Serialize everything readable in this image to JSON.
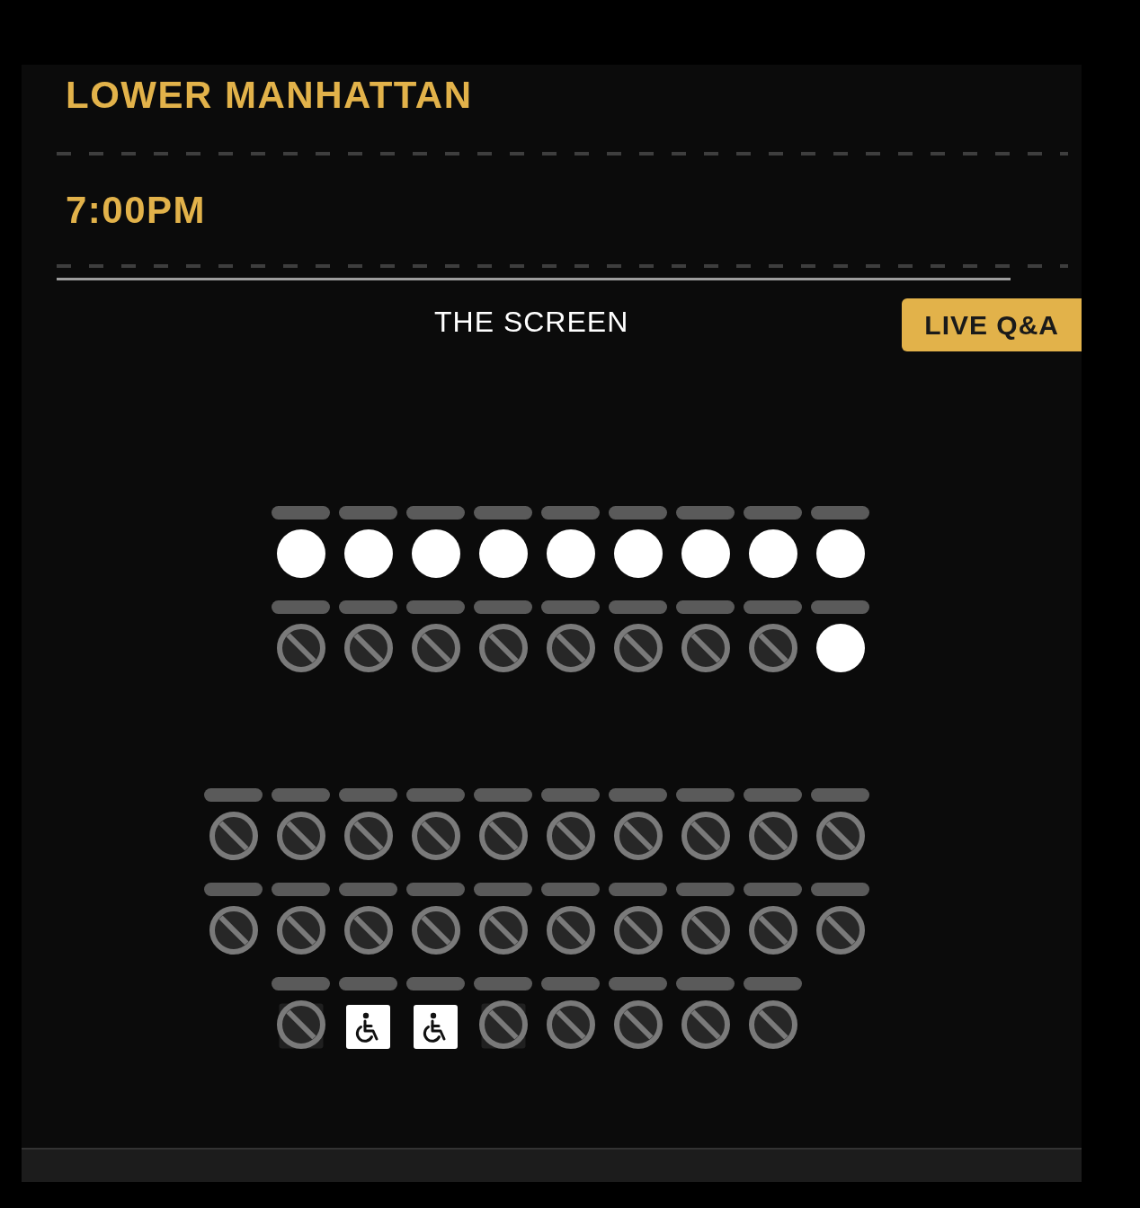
{
  "venue": {
    "location": "LOWER MANHATTAN",
    "showtime": "7:00PM"
  },
  "screen": {
    "label": "THE SCREEN",
    "tag": "LIVE Q&A"
  },
  "seating": {
    "sections": [
      {
        "rows": [
          {
            "seats": [
              {
                "kind": "open"
              },
              {
                "kind": "open"
              },
              {
                "kind": "open"
              },
              {
                "kind": "open"
              },
              {
                "kind": "open"
              },
              {
                "kind": "open"
              },
              {
                "kind": "open"
              },
              {
                "kind": "open"
              },
              {
                "kind": "open"
              }
            ]
          },
          {
            "seats": [
              {
                "kind": "blocked"
              },
              {
                "kind": "blocked"
              },
              {
                "kind": "blocked"
              },
              {
                "kind": "blocked"
              },
              {
                "kind": "blocked"
              },
              {
                "kind": "blocked"
              },
              {
                "kind": "blocked"
              },
              {
                "kind": "blocked"
              },
              {
                "kind": "open"
              }
            ]
          }
        ]
      },
      {
        "rows": [
          {
            "seats": [
              {
                "kind": "blocked"
              },
              {
                "kind": "blocked"
              },
              {
                "kind": "blocked"
              },
              {
                "kind": "blocked"
              },
              {
                "kind": "blocked"
              },
              {
                "kind": "blocked"
              },
              {
                "kind": "blocked"
              },
              {
                "kind": "blocked"
              },
              {
                "kind": "blocked"
              },
              {
                "kind": "blocked"
              }
            ]
          },
          {
            "seats": [
              {
                "kind": "blocked"
              },
              {
                "kind": "blocked"
              },
              {
                "kind": "blocked"
              },
              {
                "kind": "blocked"
              },
              {
                "kind": "blocked"
              },
              {
                "kind": "blocked"
              },
              {
                "kind": "blocked"
              },
              {
                "kind": "blocked"
              },
              {
                "kind": "blocked"
              },
              {
                "kind": "blocked"
              }
            ]
          },
          {
            "seats": [
              {
                "kind": "companion"
              },
              {
                "kind": "accessible"
              },
              {
                "kind": "accessible"
              },
              {
                "kind": "companion"
              },
              {
                "kind": "blocked"
              },
              {
                "kind": "blocked"
              },
              {
                "kind": "blocked"
              },
              {
                "kind": "blocked"
              }
            ]
          }
        ]
      }
    ]
  }
}
